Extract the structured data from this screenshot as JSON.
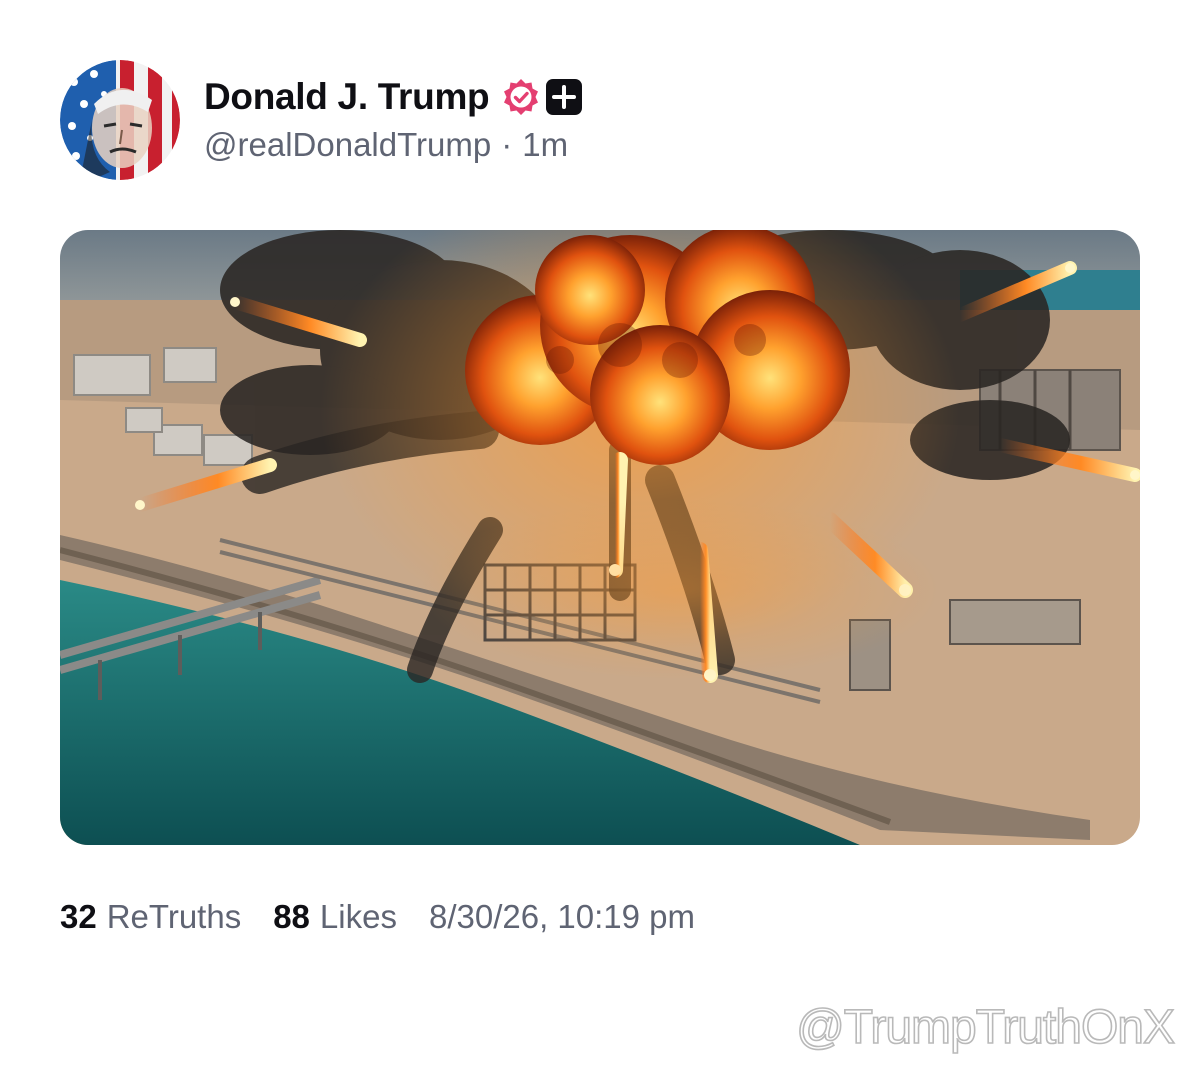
{
  "post": {
    "author": {
      "display_name": "Donald J. Trump",
      "handle": "@realDonaldTrump",
      "verified": true,
      "verified_color": "#e43f71"
    },
    "time_ago": "1m",
    "separator": "·",
    "media": {
      "icon": "explosion-image"
    },
    "stats": {
      "retruths_count": "32",
      "retruths_label": "ReTruths",
      "likes_count": "88",
      "likes_label": "Likes",
      "timestamp": "8/30/26, 10:19 pm"
    }
  },
  "watermark": {
    "text": "@TrumpTruthOnX"
  }
}
